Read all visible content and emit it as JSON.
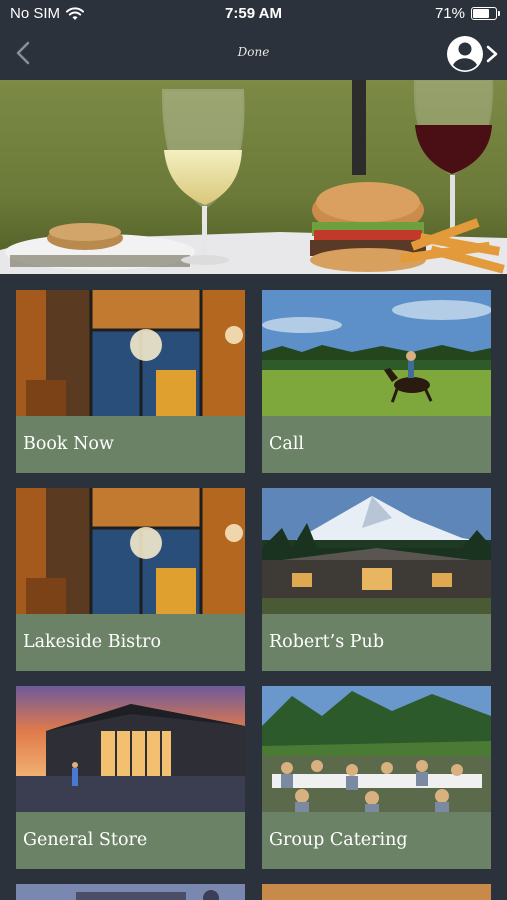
{
  "status_bar": {
    "carrier": "No SIM",
    "time": "7:59 AM",
    "battery_percent": "71%",
    "battery_level": 0.71
  },
  "nav": {
    "title": "Done",
    "back_icon": "chevron-left-icon",
    "account_icon": "user-circle-icon",
    "forward_icon": "chevron-right-icon"
  },
  "hero": {
    "description_icon": "dining-photo"
  },
  "tiles": [
    {
      "label": "Book Now",
      "image": "lodge-interior-photo"
    },
    {
      "label": "Call",
      "image": "horse-rider-meadow-photo"
    },
    {
      "label": "Lakeside Bistro",
      "image": "lodge-interior-photo"
    },
    {
      "label": "Robert’s Pub",
      "image": "mountain-lodge-photo"
    },
    {
      "label": "General Store",
      "image": "store-sunset-photo"
    },
    {
      "label": "Group Catering",
      "image": "outdoor-dining-photo"
    }
  ],
  "colors": {
    "background": "#2c323b",
    "tile_label_bg": "#6c8266",
    "text": "#ffffff"
  }
}
